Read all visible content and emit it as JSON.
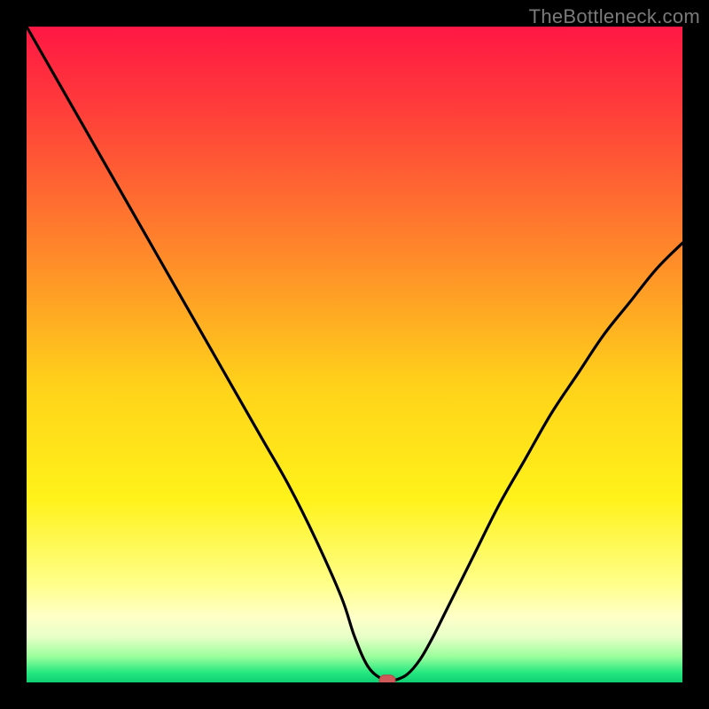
{
  "watermark": "TheBottleneck.com",
  "colors": {
    "frame_border": "#000000",
    "line": "#000000",
    "marker_fill": "#d05a5a",
    "marker_stroke": "#b74646",
    "gradient_stops": [
      {
        "offset": 0.0,
        "color": "#ff1744"
      },
      {
        "offset": 0.12,
        "color": "#ff3b3b"
      },
      {
        "offset": 0.35,
        "color": "#ff8a2a"
      },
      {
        "offset": 0.55,
        "color": "#ffd31a"
      },
      {
        "offset": 0.72,
        "color": "#fff21a"
      },
      {
        "offset": 0.85,
        "color": "#ffff8a"
      },
      {
        "offset": 0.9,
        "color": "#ffffc8"
      },
      {
        "offset": 0.93,
        "color": "#e8ffc8"
      },
      {
        "offset": 0.96,
        "color": "#9dff9d"
      },
      {
        "offset": 0.985,
        "color": "#25e880"
      },
      {
        "offset": 1.0,
        "color": "#0fcf73"
      }
    ]
  },
  "chart_data": {
    "type": "line",
    "title": "",
    "xlabel": "",
    "ylabel": "",
    "xlim": [
      0,
      100
    ],
    "ylim": [
      0,
      100
    ],
    "x": [
      0,
      4,
      8,
      12,
      16,
      20,
      24,
      28,
      32,
      36,
      40,
      44,
      48,
      50,
      52,
      54,
      55,
      56,
      58,
      60,
      62,
      64,
      68,
      72,
      76,
      80,
      84,
      88,
      92,
      96,
      100
    ],
    "series": [
      {
        "name": "bottleneck-curve",
        "values": [
          100,
          93,
          86,
          79,
          72,
          65,
          58,
          51,
          44,
          37,
          30,
          22,
          13,
          7,
          2.5,
          0.6,
          0.3,
          0.3,
          1.2,
          3.5,
          7,
          11,
          19,
          27,
          34,
          41,
          47,
          53,
          58,
          63,
          67
        ]
      }
    ],
    "marker": {
      "x": 55,
      "y": 0.3
    },
    "legend": false,
    "grid": false
  }
}
